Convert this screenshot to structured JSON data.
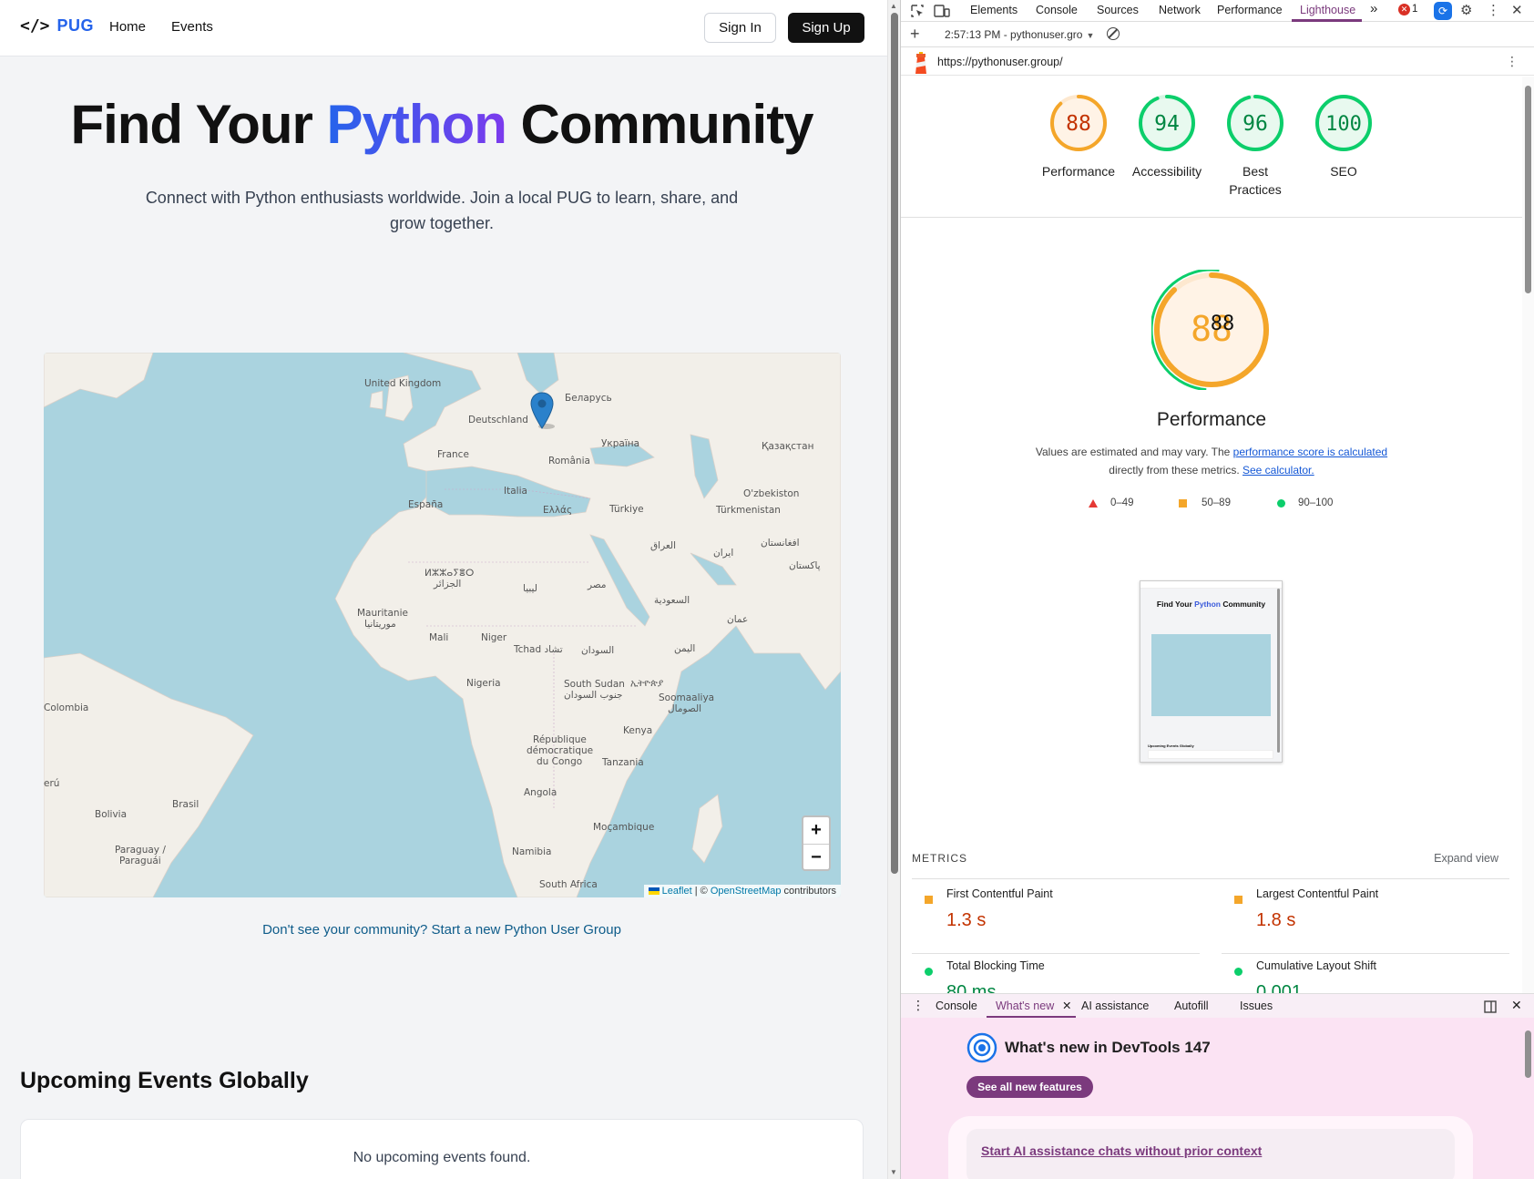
{
  "site": {
    "brand": {
      "code_glyph": "</>",
      "name": "PUG"
    },
    "nav": {
      "home": "Home",
      "events": "Events"
    },
    "sign_in": "Sign In",
    "sign_up": "Sign Up",
    "hero": {
      "title_before": "Find Your ",
      "title_highlight": "Python",
      "title_after": " Community",
      "subtitle": "Connect with Python enthusiasts worldwide. Join a local PUG to learn, share, and grow together."
    },
    "map": {
      "labels": [
        "United Kingdom",
        "Беларусь",
        "Deutschland",
        "Україна",
        "Қазақстан",
        "France",
        "România",
        "Italia",
        "O'zbekiston",
        "España",
        "Ελλάς",
        "Türkiye",
        "Türkmenistan",
        "العراق",
        "ایران",
        "افغانستان",
        "ⵍⵣⵣⴰⵢⴻⵔ",
        "الجزائر",
        "ليبيا",
        "مصر",
        "پاکستان",
        "السعودية",
        "Mauritanie",
        "موريتانيا",
        "عمان",
        "Mali",
        "Niger",
        "Tchad تشاد",
        "السودان",
        "اليمن",
        "Nigeria",
        "South Sudan",
        "جنوب السودان",
        "ኢትዮጵያ",
        "Soomaaliya",
        "الصومال",
        "Colombia",
        "Kenya",
        "République",
        "démocratique",
        "du Congo",
        "Tanzania",
        "erú",
        "Angola",
        "Brasil",
        "Bolivia",
        "Moçambique",
        "Paraguay /",
        "Paraguái",
        "Namibia",
        "South Africa"
      ],
      "zoom_in": "+",
      "zoom_out": "−",
      "attrib_leaflet": "Leaflet",
      "attrib_sep": " | © ",
      "attrib_osm": "OpenStreetMap",
      "attrib_tail": " contributors"
    },
    "start_link": "Don't see your community? Start a new Python User Group",
    "events_heading": "Upcoming Events Globally",
    "events_empty": "No upcoming events found."
  },
  "devtools": {
    "tabs": [
      "Elements",
      "Console",
      "Sources",
      "Network",
      "Performance",
      "Lighthouse"
    ],
    "more": "»",
    "error_count": "1",
    "session": "2:57:13 PM - pythonuser.gro",
    "url": "https://pythonuser.group/",
    "scores": [
      {
        "label": "Performance",
        "value": 88,
        "color": "#f4a62a"
      },
      {
        "label": "Accessibility",
        "value": 94,
        "color": "#0cce6b"
      },
      {
        "label": "Best Practices",
        "value": 96,
        "color": "#0cce6b"
      },
      {
        "label": "SEO",
        "value": 100,
        "color": "#0cce6b"
      }
    ],
    "big_gauge": {
      "value_main": "88",
      "value_overlay": "88",
      "color": "#f4a62a"
    },
    "perf_title": "Performance",
    "perf_desc_1": "Values are estimated and may vary. The ",
    "perf_desc_link1": "performance score is calculated",
    "perf_desc_2": "directly from these metrics. ",
    "perf_desc_link2": "See calculator.",
    "legend": {
      "red": "0–49",
      "orange": "50–89",
      "green": "90–100"
    },
    "thumbnail": {
      "title_before": "Find Your ",
      "title_highlight": "Python",
      "title_after": " Community",
      "events_heading": "Upcoming Events Globally"
    },
    "metrics_title": "METRICS",
    "expand": "Expand view",
    "metrics": [
      {
        "name": "First Contentful Paint",
        "value": "1.3 s",
        "status": "orange"
      },
      {
        "name": "Largest Contentful Paint",
        "value": "1.8 s",
        "status": "orange"
      },
      {
        "name": "Total Blocking Time",
        "value": "80 ms",
        "status": "green"
      },
      {
        "name": "Cumulative Layout Shift",
        "value": "0.001",
        "status": "green"
      }
    ],
    "drawer": {
      "tabs": [
        "Console",
        "What's new",
        "AI assistance",
        "Autofill",
        "Issues"
      ],
      "whats_new_title": "What's new in DevTools 147",
      "see_all": "See all new features",
      "card_link": "Start AI assistance chats without prior context"
    }
  }
}
